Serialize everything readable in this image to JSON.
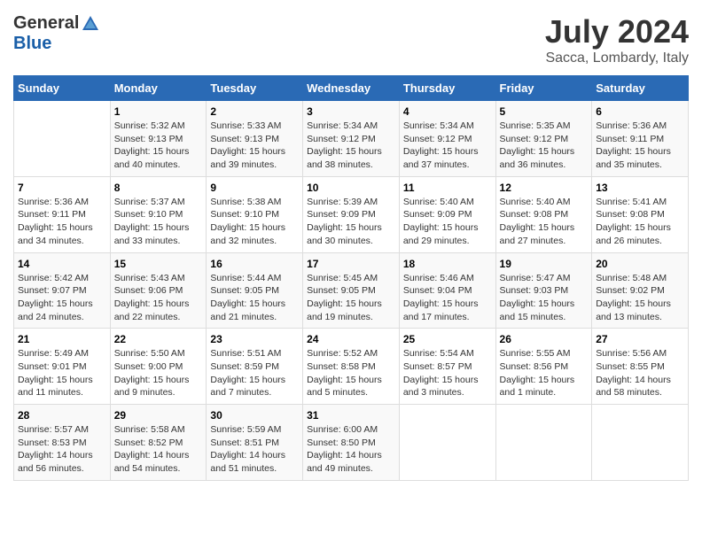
{
  "logo": {
    "general": "General",
    "blue": "Blue"
  },
  "title": "July 2024",
  "subtitle": "Sacca, Lombardy, Italy",
  "headers": [
    "Sunday",
    "Monday",
    "Tuesday",
    "Wednesday",
    "Thursday",
    "Friday",
    "Saturday"
  ],
  "weeks": [
    [
      {
        "day": "",
        "info": ""
      },
      {
        "day": "1",
        "info": "Sunrise: 5:32 AM\nSunset: 9:13 PM\nDaylight: 15 hours\nand 40 minutes."
      },
      {
        "day": "2",
        "info": "Sunrise: 5:33 AM\nSunset: 9:13 PM\nDaylight: 15 hours\nand 39 minutes."
      },
      {
        "day": "3",
        "info": "Sunrise: 5:34 AM\nSunset: 9:12 PM\nDaylight: 15 hours\nand 38 minutes."
      },
      {
        "day": "4",
        "info": "Sunrise: 5:34 AM\nSunset: 9:12 PM\nDaylight: 15 hours\nand 37 minutes."
      },
      {
        "day": "5",
        "info": "Sunrise: 5:35 AM\nSunset: 9:12 PM\nDaylight: 15 hours\nand 36 minutes."
      },
      {
        "day": "6",
        "info": "Sunrise: 5:36 AM\nSunset: 9:11 PM\nDaylight: 15 hours\nand 35 minutes."
      }
    ],
    [
      {
        "day": "7",
        "info": "Sunrise: 5:36 AM\nSunset: 9:11 PM\nDaylight: 15 hours\nand 34 minutes."
      },
      {
        "day": "8",
        "info": "Sunrise: 5:37 AM\nSunset: 9:10 PM\nDaylight: 15 hours\nand 33 minutes."
      },
      {
        "day": "9",
        "info": "Sunrise: 5:38 AM\nSunset: 9:10 PM\nDaylight: 15 hours\nand 32 minutes."
      },
      {
        "day": "10",
        "info": "Sunrise: 5:39 AM\nSunset: 9:09 PM\nDaylight: 15 hours\nand 30 minutes."
      },
      {
        "day": "11",
        "info": "Sunrise: 5:40 AM\nSunset: 9:09 PM\nDaylight: 15 hours\nand 29 minutes."
      },
      {
        "day": "12",
        "info": "Sunrise: 5:40 AM\nSunset: 9:08 PM\nDaylight: 15 hours\nand 27 minutes."
      },
      {
        "day": "13",
        "info": "Sunrise: 5:41 AM\nSunset: 9:08 PM\nDaylight: 15 hours\nand 26 minutes."
      }
    ],
    [
      {
        "day": "14",
        "info": "Sunrise: 5:42 AM\nSunset: 9:07 PM\nDaylight: 15 hours\nand 24 minutes."
      },
      {
        "day": "15",
        "info": "Sunrise: 5:43 AM\nSunset: 9:06 PM\nDaylight: 15 hours\nand 22 minutes."
      },
      {
        "day": "16",
        "info": "Sunrise: 5:44 AM\nSunset: 9:05 PM\nDaylight: 15 hours\nand 21 minutes."
      },
      {
        "day": "17",
        "info": "Sunrise: 5:45 AM\nSunset: 9:05 PM\nDaylight: 15 hours\nand 19 minutes."
      },
      {
        "day": "18",
        "info": "Sunrise: 5:46 AM\nSunset: 9:04 PM\nDaylight: 15 hours\nand 17 minutes."
      },
      {
        "day": "19",
        "info": "Sunrise: 5:47 AM\nSunset: 9:03 PM\nDaylight: 15 hours\nand 15 minutes."
      },
      {
        "day": "20",
        "info": "Sunrise: 5:48 AM\nSunset: 9:02 PM\nDaylight: 15 hours\nand 13 minutes."
      }
    ],
    [
      {
        "day": "21",
        "info": "Sunrise: 5:49 AM\nSunset: 9:01 PM\nDaylight: 15 hours\nand 11 minutes."
      },
      {
        "day": "22",
        "info": "Sunrise: 5:50 AM\nSunset: 9:00 PM\nDaylight: 15 hours\nand 9 minutes."
      },
      {
        "day": "23",
        "info": "Sunrise: 5:51 AM\nSunset: 8:59 PM\nDaylight: 15 hours\nand 7 minutes."
      },
      {
        "day": "24",
        "info": "Sunrise: 5:52 AM\nSunset: 8:58 PM\nDaylight: 15 hours\nand 5 minutes."
      },
      {
        "day": "25",
        "info": "Sunrise: 5:54 AM\nSunset: 8:57 PM\nDaylight: 15 hours\nand 3 minutes."
      },
      {
        "day": "26",
        "info": "Sunrise: 5:55 AM\nSunset: 8:56 PM\nDaylight: 15 hours\nand 1 minute."
      },
      {
        "day": "27",
        "info": "Sunrise: 5:56 AM\nSunset: 8:55 PM\nDaylight: 14 hours\nand 58 minutes."
      }
    ],
    [
      {
        "day": "28",
        "info": "Sunrise: 5:57 AM\nSunset: 8:53 PM\nDaylight: 14 hours\nand 56 minutes."
      },
      {
        "day": "29",
        "info": "Sunrise: 5:58 AM\nSunset: 8:52 PM\nDaylight: 14 hours\nand 54 minutes."
      },
      {
        "day": "30",
        "info": "Sunrise: 5:59 AM\nSunset: 8:51 PM\nDaylight: 14 hours\nand 51 minutes."
      },
      {
        "day": "31",
        "info": "Sunrise: 6:00 AM\nSunset: 8:50 PM\nDaylight: 14 hours\nand 49 minutes."
      },
      {
        "day": "",
        "info": ""
      },
      {
        "day": "",
        "info": ""
      },
      {
        "day": "",
        "info": ""
      }
    ]
  ]
}
